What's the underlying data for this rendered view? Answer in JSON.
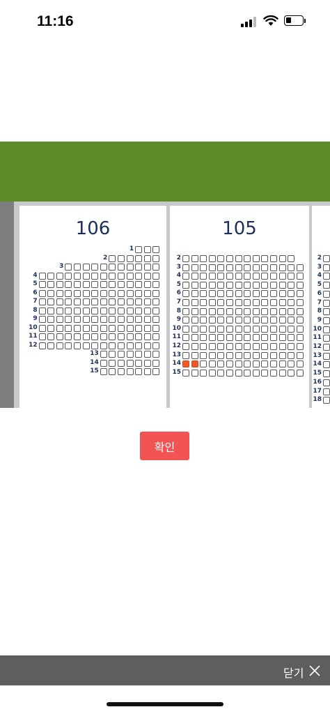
{
  "status_bar": {
    "time": "11:16"
  },
  "seat_map": {
    "blocks": [
      {
        "name": "106",
        "rows": [
          {
            "label": "1",
            "seats": 3
          },
          {
            "label": "2",
            "seats": 6
          },
          {
            "label": "3",
            "seats": 11
          },
          {
            "label": "4",
            "seats": 14
          },
          {
            "label": "5",
            "seats": 14
          },
          {
            "label": "6",
            "seats": 14
          },
          {
            "label": "7",
            "seats": 14
          },
          {
            "label": "8",
            "seats": 14
          },
          {
            "label": "9",
            "seats": 14
          },
          {
            "label": "10",
            "seats": 14
          },
          {
            "label": "11",
            "seats": 14
          },
          {
            "label": "12",
            "seats": 14
          },
          {
            "label": "13",
            "seats": 7
          },
          {
            "label": "14",
            "seats": 7
          },
          {
            "label": "15",
            "seats": 7
          }
        ],
        "selected": []
      },
      {
        "name": "105",
        "rows": [
          {
            "label": "2",
            "seats": 13
          },
          {
            "label": "3",
            "seats": 14
          },
          {
            "label": "4",
            "seats": 14
          },
          {
            "label": "5",
            "seats": 14
          },
          {
            "label": "6",
            "seats": 14
          },
          {
            "label": "7",
            "seats": 14
          },
          {
            "label": "8",
            "seats": 14
          },
          {
            "label": "9",
            "seats": 14
          },
          {
            "label": "10",
            "seats": 14
          },
          {
            "label": "11",
            "seats": 14
          },
          {
            "label": "12",
            "seats": 14
          },
          {
            "label": "13",
            "seats": 14
          },
          {
            "label": "14",
            "seats": 14
          },
          {
            "label": "15",
            "seats": 14
          }
        ],
        "selected": [
          {
            "row": "14",
            "seat": 1
          },
          {
            "row": "14",
            "seat": 2
          }
        ]
      },
      {
        "name": "",
        "rows": [
          {
            "label": "2",
            "seats": 1
          },
          {
            "label": "3",
            "seats": 1
          },
          {
            "label": "4",
            "seats": 1
          },
          {
            "label": "5",
            "seats": 1
          },
          {
            "label": "6",
            "seats": 1
          },
          {
            "label": "7",
            "seats": 1
          },
          {
            "label": "8",
            "seats": 1
          },
          {
            "label": "9",
            "seats": 1
          },
          {
            "label": "10",
            "seats": 1
          },
          {
            "label": "11",
            "seats": 1
          },
          {
            "label": "12",
            "seats": 1
          },
          {
            "label": "13",
            "seats": 1
          },
          {
            "label": "14",
            "seats": 1
          },
          {
            "label": "15",
            "seats": 1
          },
          {
            "label": "16",
            "seats": 1
          },
          {
            "label": "17",
            "seats": 1
          },
          {
            "label": "18",
            "seats": 1
          }
        ],
        "selected": []
      }
    ],
    "colors": {
      "field": "#5b8a27",
      "selected_seat": "#f05a28"
    }
  },
  "confirm_button": {
    "label": "확인"
  },
  "close_bar": {
    "label": "닫기"
  }
}
